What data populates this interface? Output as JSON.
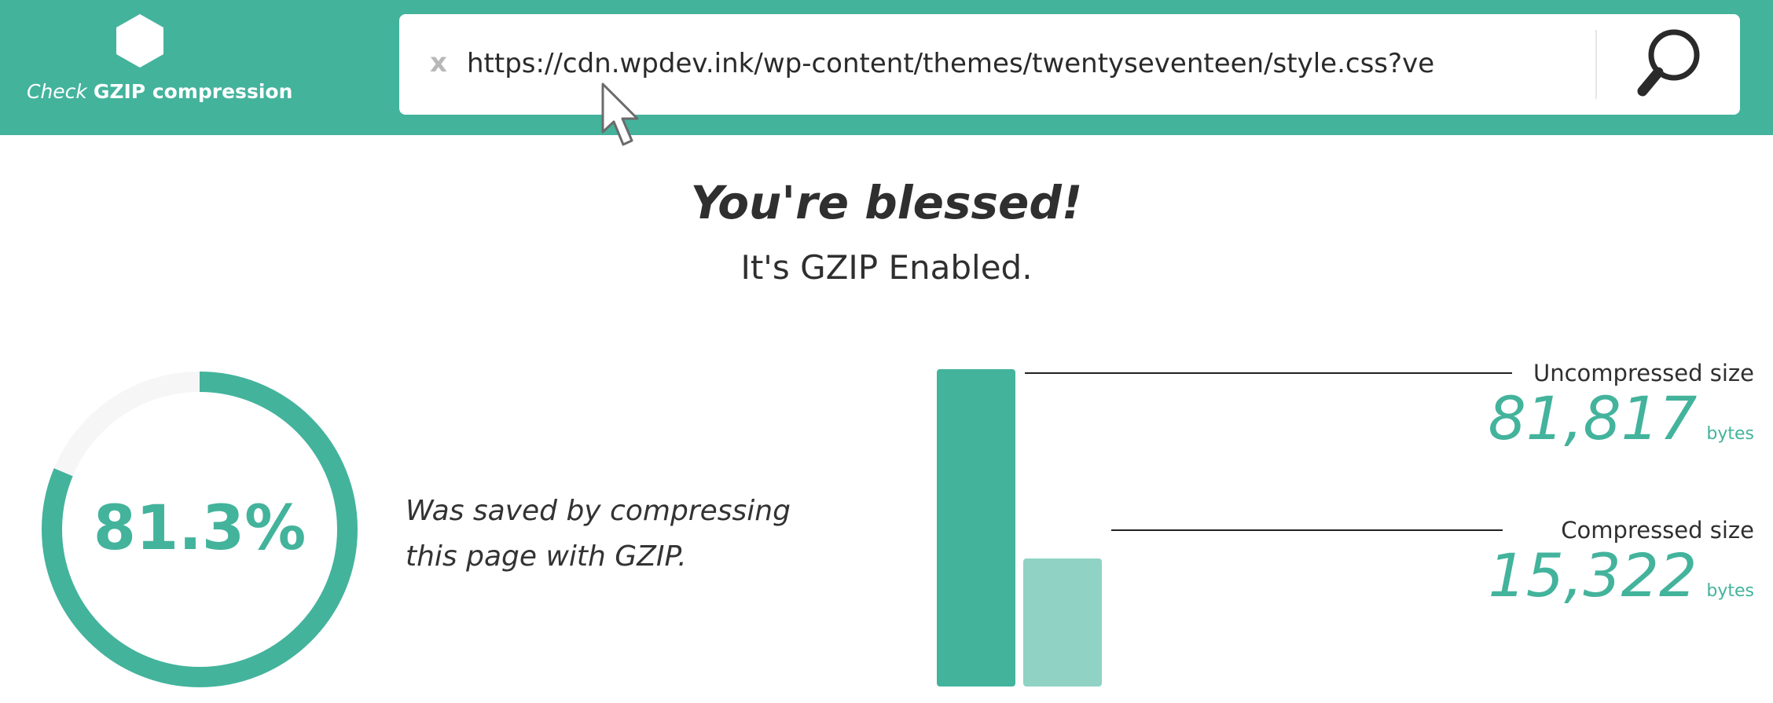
{
  "header": {
    "logo_check": "Check",
    "logo_title": "GZIP compression",
    "logo_icon": "hexagon-icon"
  },
  "search": {
    "clear_label": "x",
    "url": "https://cdn.wpdev.ink/wp-content/themes/twentyseventeen/style.css?ve",
    "search_icon": "magnifier-icon"
  },
  "result": {
    "title": "You're blessed!",
    "subtitle": "It's GZIP Enabled."
  },
  "savings": {
    "percent_label": "81.3%",
    "percent_value": 81.3,
    "description": "Was saved by compressing this page with GZIP."
  },
  "sizes": {
    "uncompressed_label": "Uncompressed size",
    "uncompressed_value": "81,817",
    "uncompressed_bytes": 81817,
    "compressed_label": "Compressed size",
    "compressed_value": "15,322",
    "compressed_bytes": 15322,
    "unit": "bytes"
  },
  "colors": {
    "brand": "#43b39c",
    "brand_light": "#90d3c4",
    "ring_track": "#f6f6f6"
  }
}
